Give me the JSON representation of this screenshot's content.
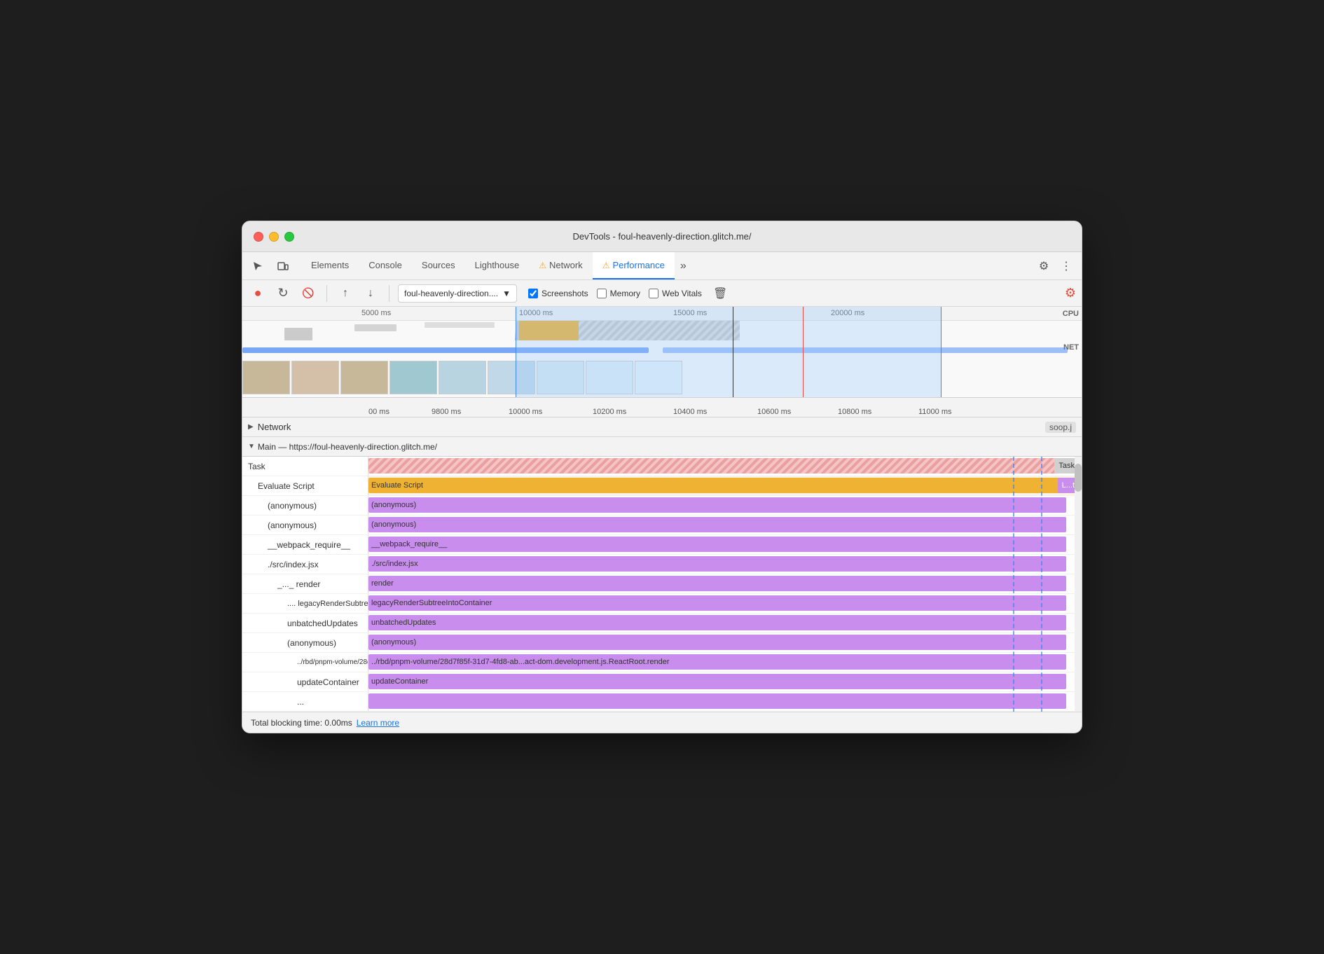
{
  "window": {
    "title": "DevTools - foul-heavenly-direction.glitch.me/"
  },
  "nav": {
    "tabs": [
      {
        "label": "Elements",
        "active": false,
        "warn": false
      },
      {
        "label": "Console",
        "active": false,
        "warn": false
      },
      {
        "label": "Sources",
        "active": false,
        "warn": false
      },
      {
        "label": "Lighthouse",
        "active": false,
        "warn": false
      },
      {
        "label": "Network",
        "active": false,
        "warn": true
      },
      {
        "label": "Performance",
        "active": true,
        "warn": true
      }
    ],
    "more_label": "»",
    "settings_label": "⚙",
    "dots_label": "⋮"
  },
  "toolbar": {
    "record_label": "●",
    "reload_label": "↻",
    "clear_label": "🚫",
    "upload_label": "↑",
    "download_label": "↓",
    "profile_selector": "foul-heavenly-direction....",
    "screenshots_label": "Screenshots",
    "memory_label": "Memory",
    "web_vitals_label": "Web Vitals",
    "trash_label": "🗑",
    "settings_label": "⚙"
  },
  "overview": {
    "ruler_marks": [
      "5000 ms",
      "10000 ms",
      "15000 ms",
      "20000 ms"
    ],
    "cpu_label": "CPU",
    "net_label": "NET"
  },
  "zoom_ruler": {
    "marks": [
      "00 ms",
      "9800 ms",
      "10000 ms",
      "10200 ms",
      "10400 ms",
      "10600 ms",
      "10800 ms",
      "11000 ms"
    ]
  },
  "network_section": {
    "label": "Network",
    "file_label": "soop.j"
  },
  "main_section": {
    "label": "Main — https://foul-heavenly-direction.glitch.me/"
  },
  "flame_rows": [
    {
      "label": "Task",
      "indent": 0,
      "type": "task",
      "end_label": "Task"
    },
    {
      "label": "Evaluate Script",
      "indent": 1,
      "type": "evaluate",
      "end_label": "L...t"
    },
    {
      "label": "(anonymous)",
      "indent": 2,
      "type": "function"
    },
    {
      "label": "(anonymous)",
      "indent": 2,
      "type": "function"
    },
    {
      "label": "__webpack_require__",
      "indent": 2,
      "type": "function"
    },
    {
      "label": "./src/index.jsx",
      "indent": 2,
      "type": "function"
    },
    {
      "label": "_..._ render",
      "indent": 3,
      "type": "function"
    },
    {
      "label": ".... legacyRenderSubtreeIntoContainer",
      "indent": 4,
      "type": "function"
    },
    {
      "label": "unbatchedUpdates",
      "indent": 4,
      "type": "function"
    },
    {
      "label": "(anonymous)",
      "indent": 4,
      "type": "function"
    },
    {
      "label": "../rbd/pnpm-volume/28d7f85f-31d7-4fd8-ab...act-dom.development.js.ReactRoot.render",
      "indent": 5,
      "type": "function"
    },
    {
      "label": "updateContainer",
      "indent": 5,
      "type": "function"
    },
    {
      "label": "...",
      "indent": 5,
      "type": "function"
    }
  ],
  "status": {
    "blocking_time_label": "Total blocking time: 0.00ms",
    "learn_more_label": "Learn more"
  }
}
